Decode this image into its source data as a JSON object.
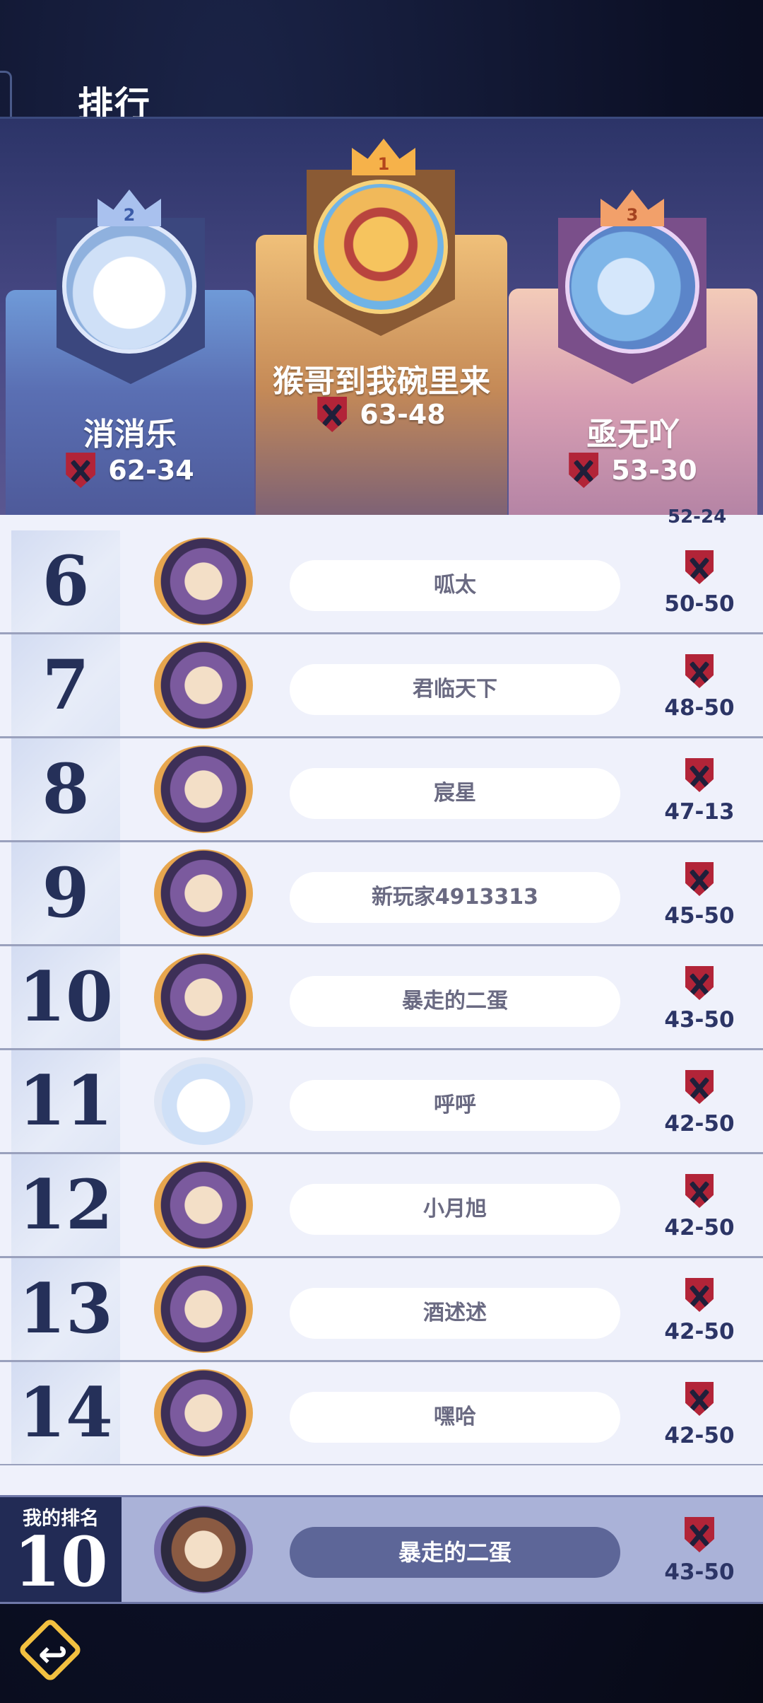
{
  "title": "排行",
  "podium": [
    {
      "place": "2",
      "name": "消消乐",
      "score": "62-34"
    },
    {
      "place": "1",
      "name": "猴哥到我碗里来",
      "score": "63-48"
    },
    {
      "place": "3",
      "name": "亟无吖",
      "score": "53-30"
    }
  ],
  "partial_row_score": "52-24",
  "rows": [
    {
      "rank": "6",
      "name": "呱太",
      "score": "50-50"
    },
    {
      "rank": "7",
      "name": "君临天下",
      "score": "48-50"
    },
    {
      "rank": "8",
      "name": "宸星",
      "score": "47-13"
    },
    {
      "rank": "9",
      "name": "新玩家4913313",
      "score": "45-50"
    },
    {
      "rank": "10",
      "name": "暴走的二蛋",
      "score": "43-50"
    },
    {
      "rank": "11",
      "name": "呼呼",
      "score": "42-50"
    },
    {
      "rank": "12",
      "name": "小月旭",
      "score": "42-50"
    },
    {
      "rank": "13",
      "name": "酒述述",
      "score": "42-50"
    },
    {
      "rank": "14",
      "name": "嘿哈",
      "score": "42-50"
    }
  ],
  "my_rank": {
    "label": "我的排名",
    "rank": "10",
    "name": "暴走的二蛋",
    "score": "43-50"
  },
  "icons": {
    "score": "crossed-swords-shield-icon",
    "back": "back-arrow-icon"
  },
  "colors": {
    "accent": "#f2c040",
    "shield_red": "#b22438",
    "my_rank_bg": "#aab2d8"
  }
}
